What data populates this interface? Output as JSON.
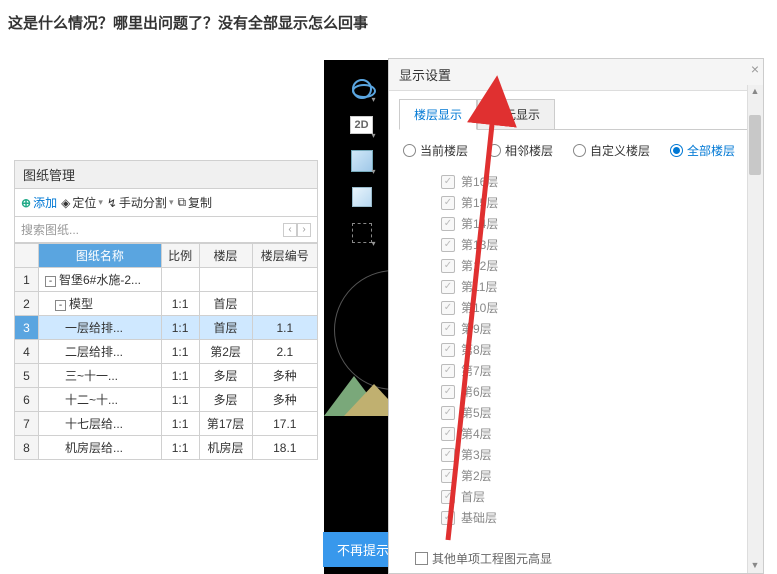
{
  "page_question": "这是什么情况？哪里出问题了？没有全部显示怎么回事",
  "left": {
    "header": "图纸管理",
    "toolbar": {
      "add": "添加",
      "locate": "定位",
      "split": "手动分割",
      "copy": "复制"
    },
    "search_placeholder": "搜索图纸...",
    "columns": {
      "name": "图纸名称",
      "scale": "比例",
      "floor": "楼层",
      "floor_no": "楼层编号"
    },
    "rows": [
      {
        "idx": "1",
        "name": "智堡6#水施-2...",
        "scale": "",
        "floor": "",
        "floor_no": "",
        "tree": "-",
        "indent": 0
      },
      {
        "idx": "2",
        "name": "模型",
        "scale": "1:1",
        "floor": "首层",
        "floor_no": "",
        "tree": "-",
        "indent": 1
      },
      {
        "idx": "3",
        "name": "一层给排...",
        "scale": "1:1",
        "floor": "首层",
        "floor_no": "1.1",
        "selected": true,
        "indent": 2
      },
      {
        "idx": "4",
        "name": "二层给排...",
        "scale": "1:1",
        "floor": "第2层",
        "floor_no": "2.1",
        "indent": 2
      },
      {
        "idx": "5",
        "name": "三~十一...",
        "scale": "1:1",
        "floor": "多层",
        "floor_no": "多种",
        "indent": 2
      },
      {
        "idx": "6",
        "name": "十二~十...",
        "scale": "1:1",
        "floor": "多层",
        "floor_no": "多种",
        "indent": 2
      },
      {
        "idx": "7",
        "name": "十七层给...",
        "scale": "1:1",
        "floor": "第17层",
        "floor_no": "17.1",
        "indent": 2
      },
      {
        "idx": "8",
        "name": "机房层给...",
        "scale": "1:1",
        "floor": "机房层",
        "floor_no": "18.1",
        "indent": 2
      }
    ]
  },
  "vert": {
    "label_2d": "2D"
  },
  "blue_hint": "不再提示",
  "right": {
    "title": "显示设置",
    "tabs": {
      "floor": "楼层显示",
      "element": "图元显示"
    },
    "radios": {
      "current": "当前楼层",
      "adjacent": "相邻楼层",
      "custom": "自定义楼层",
      "all": "全部楼层"
    },
    "floors": [
      "第16层",
      "第15层",
      "第14层",
      "第13层",
      "第12层",
      "第11层",
      "第10层",
      "第9层",
      "第8层",
      "第7层",
      "第6层",
      "第5层",
      "第4层",
      "第3层",
      "第2层",
      "首层",
      "基础层"
    ],
    "bottom_label": "其他单项工程图元高显"
  }
}
